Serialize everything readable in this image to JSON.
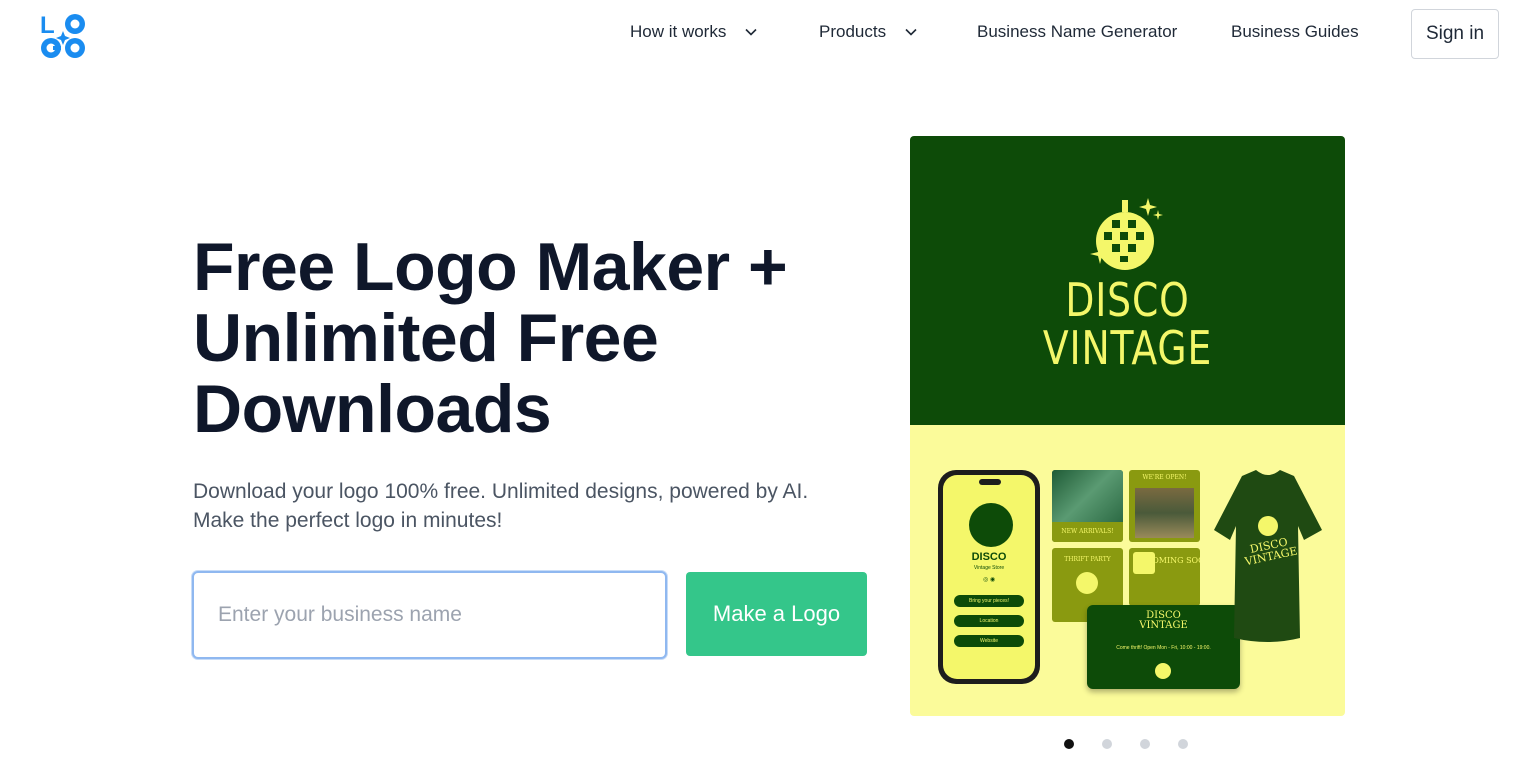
{
  "header": {
    "logo_text": "LOGO",
    "nav": [
      {
        "label": "How it works",
        "has_dropdown": true
      },
      {
        "label": "Products",
        "has_dropdown": true
      },
      {
        "label": "Business Name Generator",
        "has_dropdown": false
      },
      {
        "label": "Business Guides",
        "has_dropdown": false
      }
    ],
    "signin_label": "Sign in"
  },
  "hero": {
    "headline_line1": "Free Logo Maker +",
    "headline_line2": "Unlimited Free",
    "headline_line3": "Downloads",
    "subtext": "Download your logo 100% free. Unlimited designs, powered by AI. Make the perfect logo in minutes!",
    "input_placeholder": "Enter your business name",
    "input_value": "",
    "cta_label": "Make a Logo"
  },
  "showcase": {
    "brand_line1": "DISCO",
    "brand_line2": "VINTAGE",
    "phone": {
      "name": "DISCO",
      "sub": "Vintage Store",
      "buttons": [
        "Bring your pieces!",
        "Location",
        "Website"
      ]
    },
    "tiles": [
      "NEW ARRIVALS!",
      "WE'RE OPEN!",
      "THRIFT PARTY",
      "COMING SOON!"
    ],
    "card": {
      "title_line1": "DISCO",
      "title_line2": "VINTAGE",
      "line": "Come thrift! Open Mon - Fri, 10:00 - 19:00."
    },
    "shirt_line1": "DISCO",
    "shirt_line2": "VINTAGE",
    "colors": {
      "dark_green": "#0d4b08",
      "yellow": "#f4f76a",
      "light_yellow": "#fbfb9a"
    }
  },
  "carousel": {
    "slide_count": 4,
    "active_index": 0
  },
  "colors": {
    "brand_blue": "#1a8cf0",
    "cta_green": "#34c68a",
    "heading": "#0f172a"
  }
}
